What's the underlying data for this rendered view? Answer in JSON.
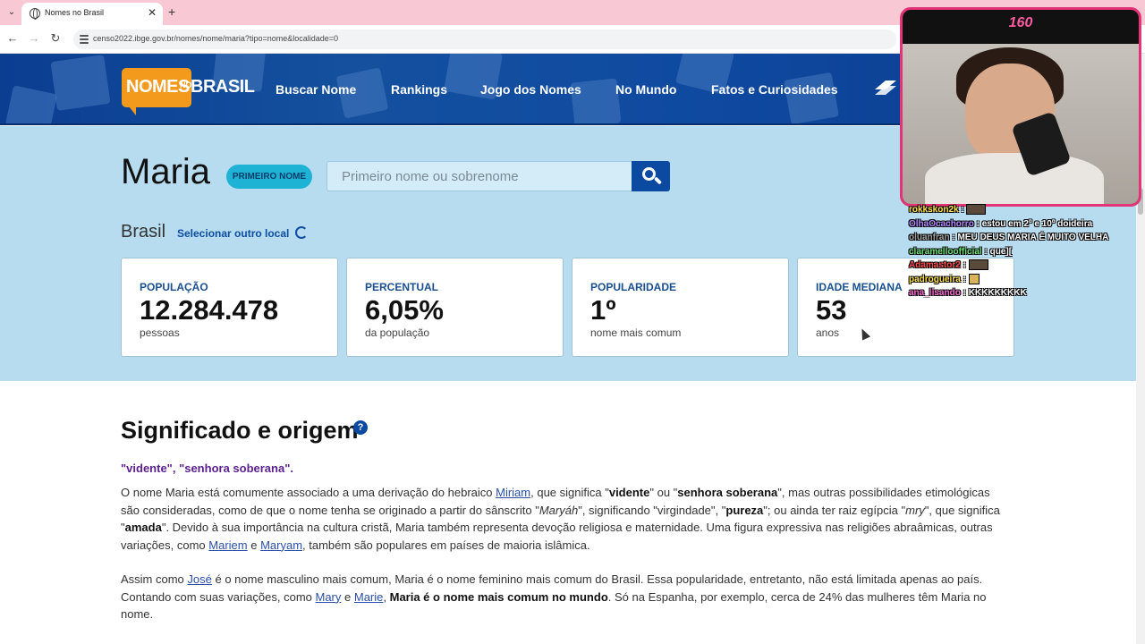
{
  "browser": {
    "tab_title": "Nomes no Brasil",
    "url": "censo2022.ibge.gov.br/nomes/nome/maria?tipo=nome&localidade=0",
    "new_tab": "+",
    "close": "✕",
    "back": "←",
    "forward": "→",
    "reload": "↻",
    "menu": "⌄"
  },
  "site": {
    "logo_nomes": "NOMES",
    "logo_no": "NO",
    "logo_brasil": "BRASIL",
    "nav": [
      "Buscar Nome",
      "Rankings",
      "Jogo dos Nomes",
      "No Mundo",
      "Fatos e Curiosidades"
    ]
  },
  "hero": {
    "name": "Maria",
    "badge": "PRIMEIRO NOME",
    "search_placeholder": "Primeiro nome ou sobrenome",
    "place": "Brasil",
    "change_location": "Selecionar outro local"
  },
  "stats": [
    {
      "label": "POPULAÇÃO",
      "value": "12.284.478",
      "sub": "pessoas"
    },
    {
      "label": "PERCENTUAL",
      "value": "6,05%",
      "sub": "da população"
    },
    {
      "label": "POPULARIDADE",
      "value": "1º",
      "sub": "nome mais comum"
    },
    {
      "label": "IDADE MEDIANA",
      "value": "53",
      "sub": "anos"
    }
  ],
  "content": {
    "section_title": "Significado e origem",
    "help": "?",
    "meaning": "\"vidente\", \"senhora soberana\".",
    "p1": {
      "t1": "O nome Maria está comumente associado a uma derivação do hebraico ",
      "link_miriam": "Miriam",
      "t2": ", que significa \"",
      "b_vidente": "vidente",
      "t3": "\" ou \"",
      "b_senhora": "senhora soberana",
      "t4": "\", mas outras possibilidades etimológicas são consideradas, como de que o nome tenha se originado a partir do sânscrito \"",
      "i_maryah": "Maryáh",
      "t5": "\", significando \"virgindade\", \"",
      "b_pureza": "pureza",
      "t6": "\"; ou ainda ter raiz egípcia \"",
      "i_mry": "mry",
      "t7": "\", que significa \"",
      "b_amada": "amada",
      "t8": "\". Devido à sua importância na cultura cristã, Maria também representa devoção religiosa e maternidade. Uma figura expressiva nas religiões abraâmicas, outras variações, como ",
      "link_mariem": "Mariem",
      "t9": " e ",
      "link_maryam": "Maryam",
      "t10": ", também são populares em países de maioria islâmica."
    },
    "p2": {
      "t1": "Assim como ",
      "link_jose": "José",
      "t2": " é o nome masculino mais comum, Maria é o nome feminino mais comum do Brasil. Essa popularidade, entretanto, não está limitada apenas ao país. Contando com suas variações, como ",
      "link_mary": "Mary",
      "t3": " e ",
      "link_marie": "Marie",
      "t4": ", ",
      "b_mundo": "Maria é o nome mais comum no mundo",
      "t5": ". Só na Espanha, por exemplo, cerca de 24% das mulheres têm Maria no nome."
    }
  },
  "stream": {
    "counter": "160",
    "chat": [
      {
        "user": "rokkskon2k",
        "color": "#ffe14d",
        "msg": ""
      },
      {
        "user": "OlhaOcachorro",
        "color": "#b388ff",
        "msg": "estou em 2º e 10º doideira"
      },
      {
        "user": "oluanfran",
        "color": "#a0a0a0",
        "msg": "MEU DEUS MARIA É MUITO VELHA"
      },
      {
        "user": "claramelloofficial",
        "color": "#6ee07a",
        "msg": "que]["
      },
      {
        "user": "Adamastor2",
        "color": "#ff4d4d",
        "msg": ""
      },
      {
        "user": "padrogueira",
        "color": "#ffe14d",
        "msg": ""
      },
      {
        "user": "ana_lisando",
        "color": "#ff6ad5",
        "msg": "KKKKKKKKK"
      }
    ]
  }
}
